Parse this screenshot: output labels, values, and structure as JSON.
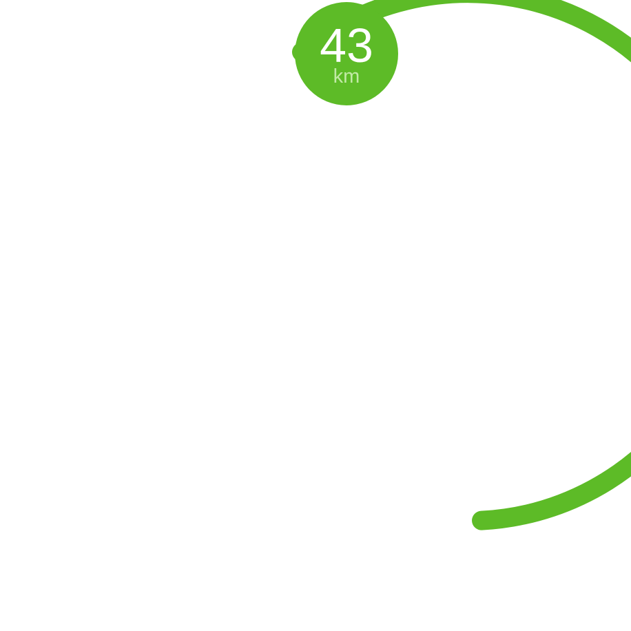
{
  "gauge": {
    "value": "43",
    "unit": "km",
    "progress_fraction": 0.6,
    "colors": {
      "accent": "#5dbb27",
      "unit_text": "#c2eaa6",
      "value_text": "#ffffff",
      "background": "#ffffff"
    }
  }
}
